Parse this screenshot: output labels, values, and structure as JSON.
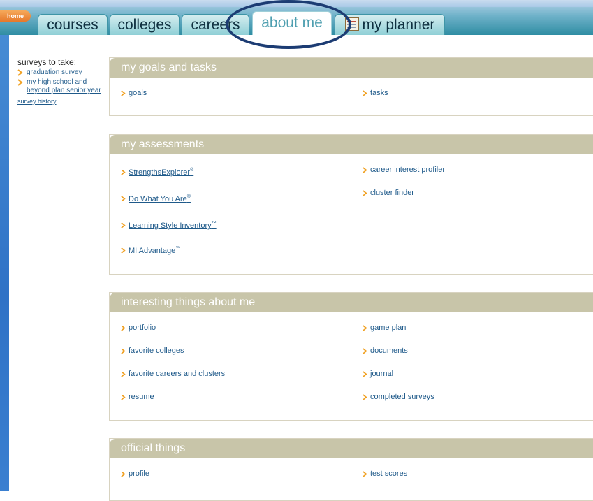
{
  "nav": {
    "home": "home",
    "tabs": [
      "courses",
      "colleges",
      "careers",
      "about me",
      "my planner"
    ],
    "active_tab": "about me"
  },
  "sidebar": {
    "title": "surveys to take:",
    "items": [
      "graduation survey",
      "my high school and beyond plan senior year"
    ],
    "history": "survey history"
  },
  "panels": {
    "goals": {
      "title": "my goals and tasks",
      "left": [
        "goals"
      ],
      "right": [
        "tasks"
      ]
    },
    "assessments": {
      "title": "my assessments",
      "left": [
        "StrengthsExplorer",
        "Do What You Are",
        "Learning Style Inventory",
        "MI Advantage"
      ],
      "left_marks": [
        "®",
        "®",
        "™",
        "™"
      ],
      "right": [
        "career interest profiler",
        "cluster finder"
      ]
    },
    "interesting": {
      "title": "interesting things about me",
      "left": [
        "portfolio",
        "favorite colleges",
        "favorite careers and clusters",
        "resume"
      ],
      "right": [
        "game plan",
        "documents",
        "journal",
        "completed surveys"
      ]
    },
    "official": {
      "title": "official things",
      "left": [
        "profile"
      ],
      "right": [
        "test scores"
      ]
    }
  },
  "colors": {
    "accent_teal": "#2f8da3",
    "panel_header": "#c8c5a9",
    "link": "#1f5a8a",
    "chevron": "#f0a020",
    "highlight": "#1c3c73"
  },
  "icons": {
    "chevron": "chevron-right-icon",
    "planner": "planner-icon"
  }
}
